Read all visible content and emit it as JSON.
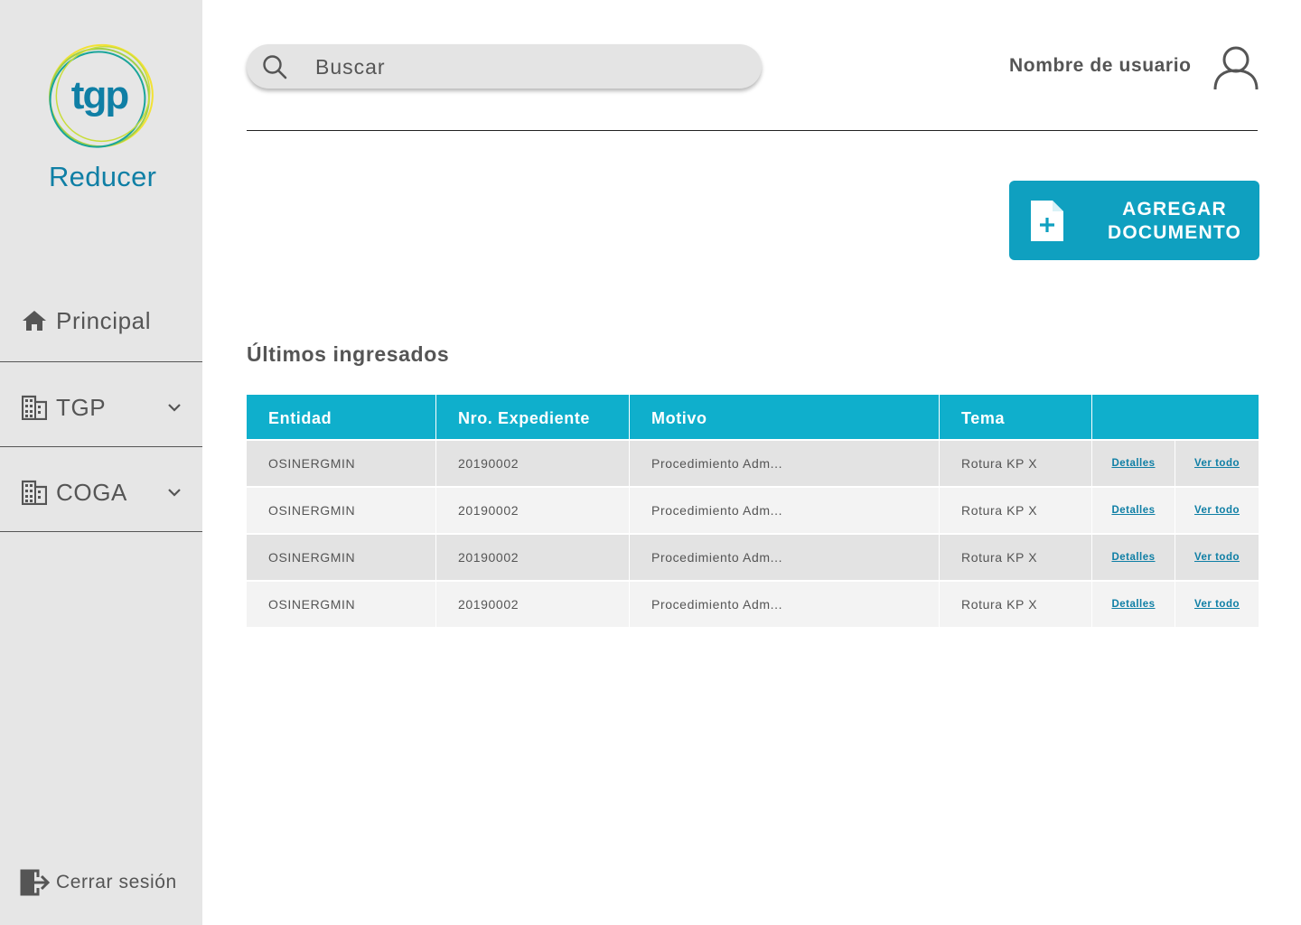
{
  "sidebar": {
    "logo_text": "tgp",
    "brand": "Reducer",
    "nav": {
      "principal": {
        "label": "Principal",
        "icon": "home-icon"
      },
      "tgp": {
        "label": "TGP",
        "icon": "building-icon"
      },
      "coga": {
        "label": "COGA",
        "icon": "building-icon"
      }
    },
    "logout": {
      "label": "Cerrar sesión",
      "icon": "logout-icon"
    }
  },
  "header": {
    "search": {
      "placeholder": "Buscar",
      "value": ""
    },
    "user_name": "Nombre de usuario"
  },
  "actions": {
    "add_document": {
      "line1": "AGREGAR",
      "line2": "DOCUMENTO"
    }
  },
  "section": {
    "title": "Últimos ingresados"
  },
  "table": {
    "columns": [
      "Entidad",
      "Nro. Expediente",
      "Motivo",
      "Tema",
      ""
    ],
    "rows": [
      {
        "entidad": "OSINERGMIN",
        "expediente": "20190002",
        "motivo": "Procedimiento Adm...",
        "tema": "Rotura KP X",
        "detalles": "Detalles",
        "ver_todo": "Ver todo"
      },
      {
        "entidad": "OSINERGMIN",
        "expediente": "20190002",
        "motivo": "Procedimiento Adm...",
        "tema": "Rotura KP X",
        "detalles": "Detalles",
        "ver_todo": "Ver todo"
      },
      {
        "entidad": "OSINERGMIN",
        "expediente": "20190002",
        "motivo": "Procedimiento Adm...",
        "tema": "Rotura KP X",
        "detalles": "Detalles",
        "ver_todo": "Ver todo"
      },
      {
        "entidad": "OSINERGMIN",
        "expediente": "20190002",
        "motivo": "Procedimiento Adm...",
        "tema": "Rotura KP X",
        "detalles": "Detalles",
        "ver_todo": "Ver todo"
      }
    ]
  },
  "colors": {
    "sidebar_bg": "#e6e6e6",
    "brand_teal": "#0f7fa5",
    "table_header": "#0fafcc",
    "button_bg": "#0fa0c0",
    "row_dark": "#e3e3e3",
    "row_light": "#f3f3f3",
    "text": "#555555"
  }
}
